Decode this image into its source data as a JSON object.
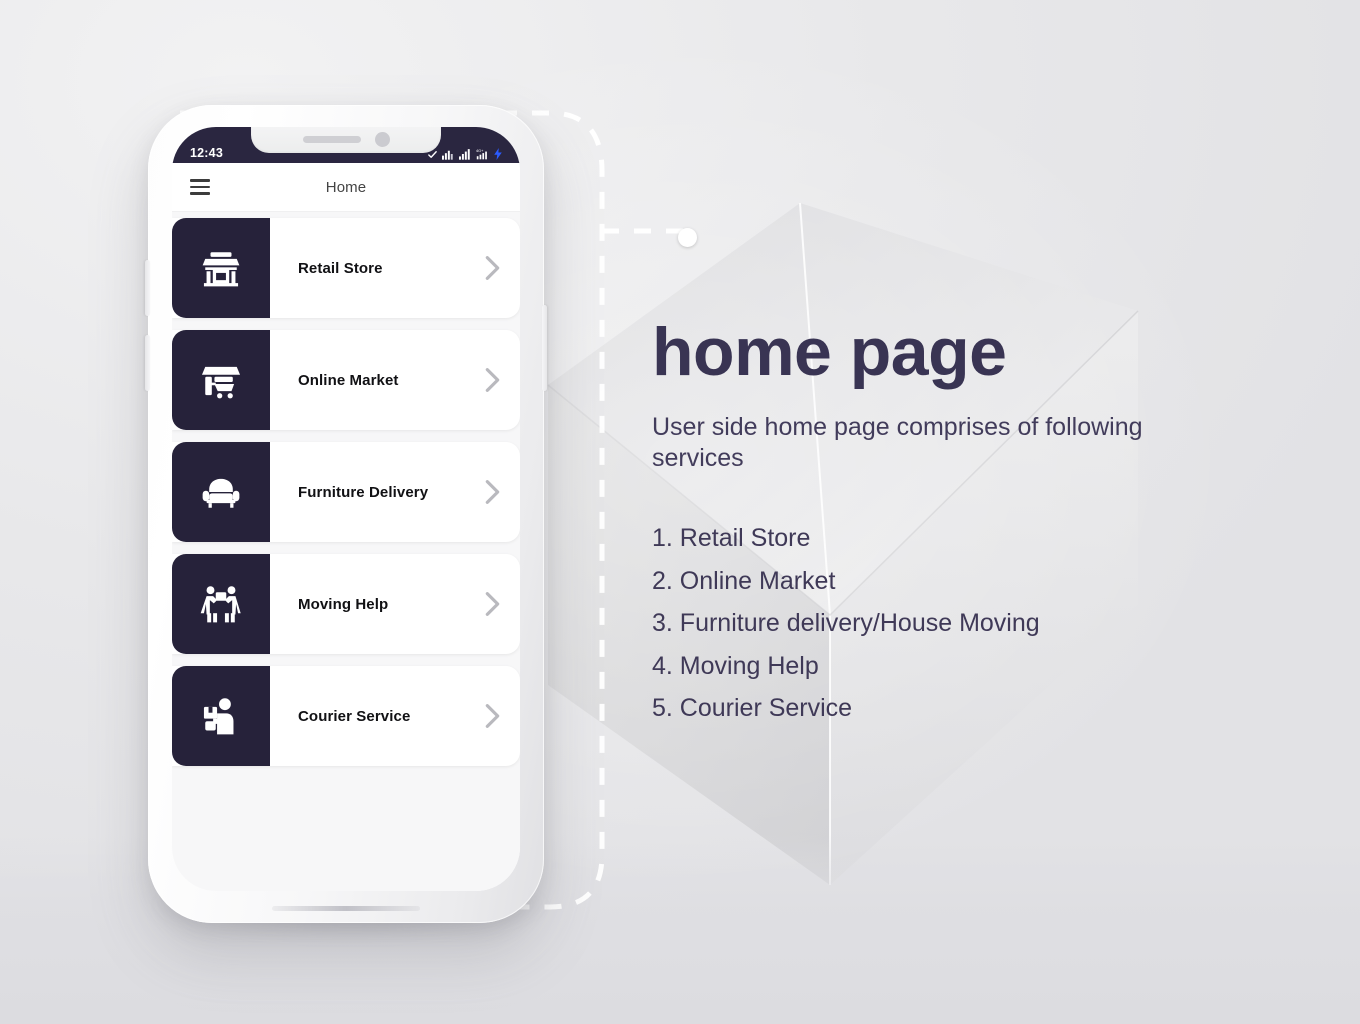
{
  "phone": {
    "status_bar": {
      "time": "12:43",
      "icons": [
        "check-icon",
        "signal-bars-icon",
        "signal-bars-icon",
        "4g-signal-icon",
        "lightning-bolt-icon"
      ]
    },
    "app_bar": {
      "menu_icon": "hamburger-menu-icon",
      "title": "Home"
    },
    "list_items": [
      {
        "label": "Retail Store",
        "icon": "storefront-icon",
        "chevron": "chevron-right-icon"
      },
      {
        "label": "Online Market",
        "icon": "market-cart-icon",
        "chevron": "chevron-right-icon"
      },
      {
        "label": "Furniture Delivery",
        "icon": "armchair-icon",
        "chevron": "chevron-right-icon"
      },
      {
        "label": "Moving Help",
        "icon": "movers-icon",
        "chevron": "chevron-right-icon"
      },
      {
        "label": "Courier Service",
        "icon": "courier-person-icon",
        "chevron": "chevron-right-icon"
      }
    ]
  },
  "content": {
    "headline": "home page",
    "subtitle": "User side home page comprises of following services",
    "services": [
      "1. Retail Store",
      "2. Online Market",
      "3. Furniture delivery/House Moving",
      "4. Moving Help",
      "5. Courier Service"
    ]
  },
  "colors": {
    "dark_navy": "#26223a",
    "headline_purple": "#393453",
    "status_bar": "#2a2640",
    "background": "#e9e9eb",
    "accent_blue": "#2b5bff"
  }
}
